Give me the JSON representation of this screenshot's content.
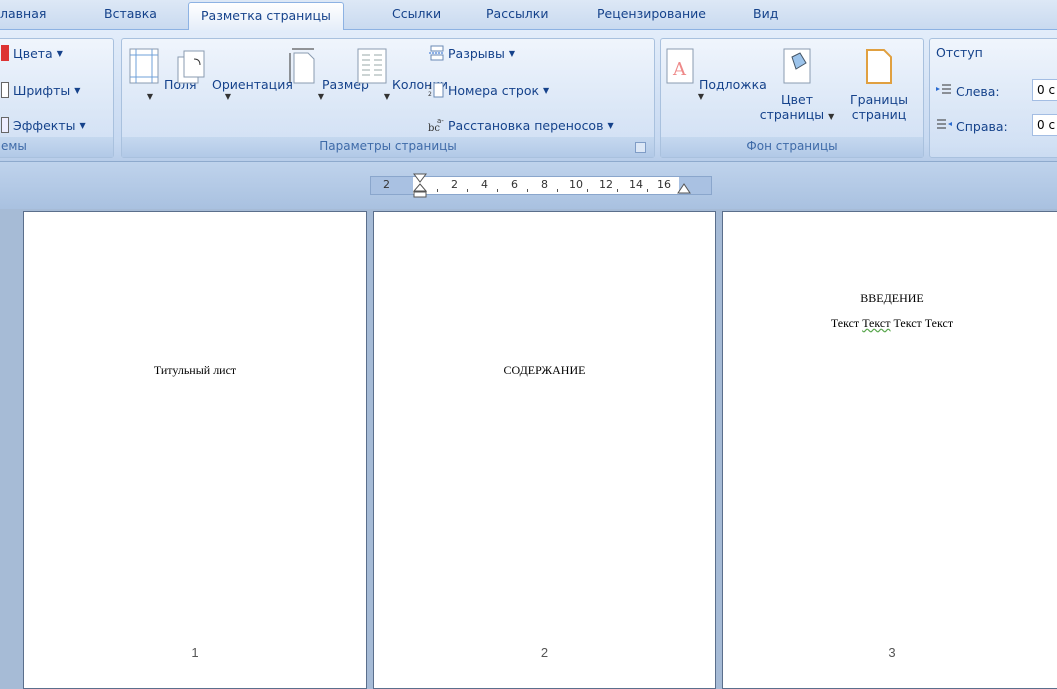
{
  "tabs": [
    "лавная",
    "Вставка",
    "Разметка страницы",
    "Ссылки",
    "Рассылки",
    "Рецензирование",
    "Вид"
  ],
  "ribbon": {
    "themes": {
      "colors": "Цвета",
      "fonts": "Шрифты",
      "effects": "Эффекты",
      "label": "емы"
    },
    "page_setup": {
      "margins": "Поля",
      "orientation": "Ориентация",
      "size": "Размер",
      "columns": "Колонки",
      "breaks": "Разрывы",
      "line_numbers": "Номера строк",
      "hyphenation": "Расстановка переносов",
      "label": "Параметры страницы"
    },
    "page_background": {
      "watermark": "Подложка",
      "page_color_line1": "Цвет",
      "page_color_line2": "страницы",
      "page_borders_line1": "Границы",
      "page_borders_line2": "страниц",
      "label": "Фон страницы"
    },
    "paragraph": {
      "indent_title": "Отступ",
      "left_label": "Слева:",
      "left_value": "0 с",
      "right_label": "Справа:",
      "right_value": "0 с"
    }
  },
  "ruler": {
    "numbers": [
      "2",
      "2",
      "4",
      "6",
      "8",
      "10",
      "12",
      "14",
      "16"
    ]
  },
  "pages": [
    {
      "text": "Титульный лист",
      "number": "1"
    },
    {
      "text": "СОДЕРЖАНИЕ",
      "number": "2"
    },
    {
      "heading": "ВВЕДЕНИЕ",
      "body_a": "Текст",
      "body_b": "Текст",
      "body_c": "Текст Текст",
      "number": "3"
    }
  ],
  "colors": {
    "ribbon_text": "#15428b",
    "workspace": "#a6bbd6"
  }
}
